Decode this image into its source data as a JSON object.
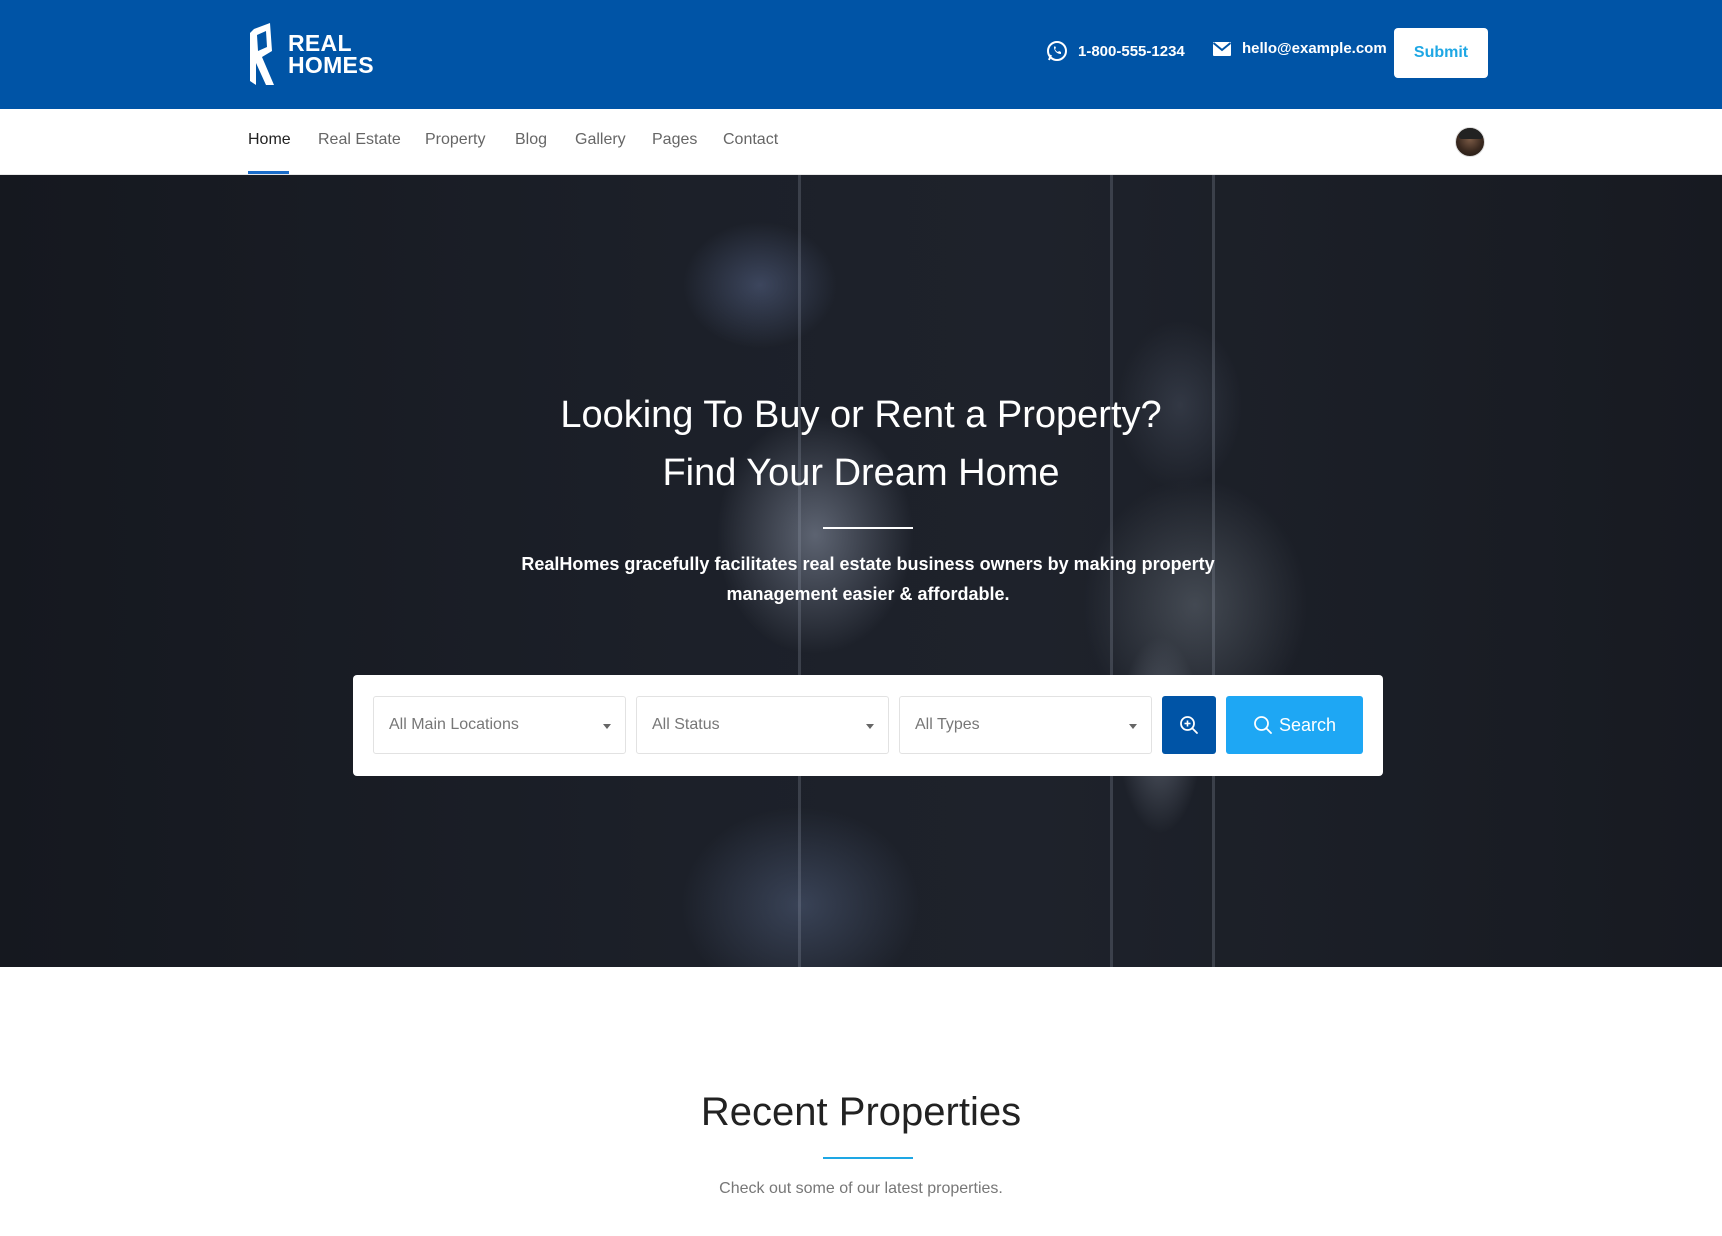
{
  "brand": {
    "name_line1": "REAL",
    "name_line2": "HOMES"
  },
  "header": {
    "phone": "1-800-555-1234",
    "email": "hello@example.com",
    "submit_label": "Submit"
  },
  "nav": {
    "items": [
      {
        "label": "Home",
        "active": true
      },
      {
        "label": "Real Estate"
      },
      {
        "label": "Property"
      },
      {
        "label": "Blog"
      },
      {
        "label": "Gallery"
      },
      {
        "label": "Pages"
      },
      {
        "label": "Contact"
      }
    ]
  },
  "hero": {
    "title_line1": "Looking To Buy or Rent a Property?",
    "title_line2": "Find Your Dream Home",
    "description": "RealHomes gracefully facilitates real estate business owners by making property management easier & affordable."
  },
  "search": {
    "location": "All Main Locations",
    "status": "All Status",
    "type": "All Types",
    "button_label": "Search"
  },
  "recent": {
    "title": "Recent Properties",
    "subtitle": "Check out some of our latest properties."
  },
  "colors": {
    "header_bg": "#0054a6",
    "accent": "#1ea7f4",
    "submit_text": "#1ea7e4"
  }
}
